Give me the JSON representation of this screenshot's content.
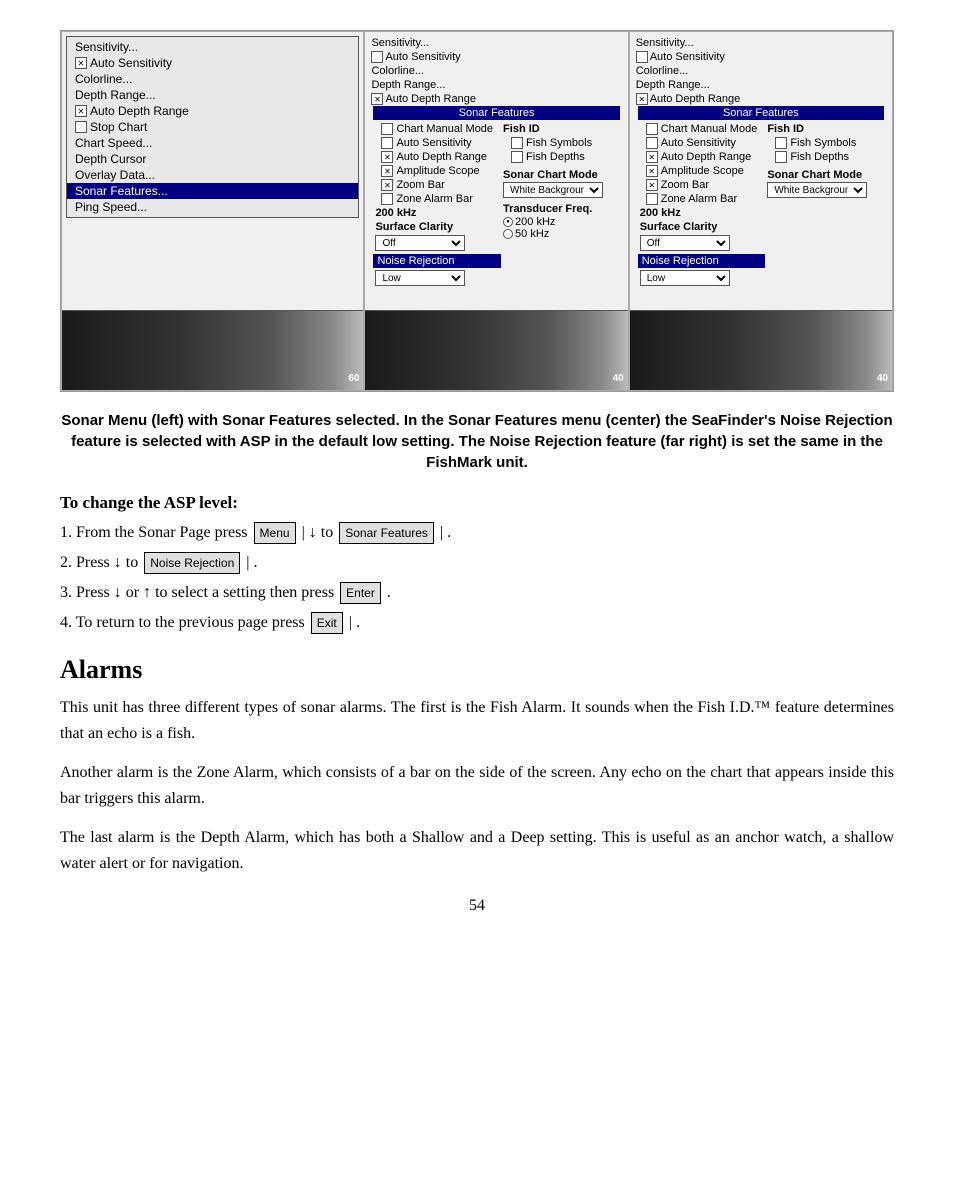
{
  "panels": {
    "left": {
      "menu_items": [
        {
          "label": "Sensitivity...",
          "selected": false,
          "checkbox": false
        },
        {
          "label": "Auto Sensitivity",
          "selected": false,
          "checkbox": true,
          "checked": true
        },
        {
          "label": "Colorline...",
          "selected": false,
          "checkbox": false
        },
        {
          "label": "Depth Range...",
          "selected": false,
          "checkbox": false
        },
        {
          "label": "Auto Depth Range",
          "selected": false,
          "checkbox": true,
          "checked": true
        },
        {
          "label": "Stop Chart",
          "selected": false,
          "checkbox": true,
          "checked": false
        },
        {
          "label": "Chart Speed...",
          "selected": false,
          "checkbox": false
        },
        {
          "label": "Depth Cursor",
          "selected": false,
          "checkbox": false
        },
        {
          "label": "Overlay Data...",
          "selected": false,
          "checkbox": false
        },
        {
          "label": "Sonar Features...",
          "selected": true,
          "checkbox": false
        },
        {
          "label": "Ping Speed...",
          "selected": false,
          "checkbox": false
        }
      ],
      "depth": "60"
    },
    "center": {
      "header": "Sonar Features",
      "col1_items": [
        {
          "label": "Chart Manual Mode",
          "checked": false
        },
        {
          "label": "Auto Sensitivity",
          "checked": false
        },
        {
          "label": "Auto Depth Range",
          "checked": true
        },
        {
          "label": "Amplitude Scope",
          "checked": true
        },
        {
          "label": "Zoom Bar",
          "checked": true
        },
        {
          "label": "Zone Alarm Bar",
          "checked": false
        }
      ],
      "freq_label": "200 kHz",
      "surface_label": "Surface Clarity",
      "surface_value": "Off",
      "noise_label": "Noise Rejection",
      "noise_value": "Low",
      "col2_title": "Fish ID",
      "fish_symbols": {
        "label": "Fish Symbols",
        "checked": false
      },
      "fish_depths": {
        "label": "Fish Depths",
        "checked": false
      },
      "chart_mode_label": "Sonar Chart Mode",
      "chart_mode_value": "White Background",
      "transducer_label": "Transducer Freq.",
      "transducer_200": "200 kHz",
      "transducer_50": "50 kHz",
      "transducer_200_selected": true,
      "depth": "40"
    },
    "right": {
      "header": "Sonar Features",
      "col1_items": [
        {
          "label": "Chart Manual Mode",
          "checked": false
        },
        {
          "label": "Auto Sensitivity",
          "checked": false
        },
        {
          "label": "Auto Depth Range",
          "checked": true
        },
        {
          "label": "Amplitude Scope",
          "checked": true
        },
        {
          "label": "Zoom Bar",
          "checked": true
        },
        {
          "label": "Zone Alarm Bar",
          "checked": false
        }
      ],
      "freq_label": "200 kHz",
      "surface_label": "Surface Clarity",
      "surface_value": "Off",
      "noise_label": "Noise Rejection",
      "noise_value": "Low",
      "col2_title": "Fish ID",
      "fish_symbols": {
        "label": "Fish Symbols",
        "checked": false
      },
      "fish_depths": {
        "label": "Fish Depths",
        "checked": false
      },
      "chart_mode_label": "Sonar Chart Mode",
      "chart_mode_value": "White Background",
      "depth": "40"
    }
  },
  "caption": "Sonar Menu (left) with Sonar Features selected. In the Sonar Features menu (center) the SeaFinder's Noise Rejection feature is selected with ASP in the default low  setting. The Noise Rejection feature (far right) is set the same in the FishMark unit.",
  "instructions": {
    "title": "To change the ASP level:",
    "steps": [
      "1. From the Sonar Page press",
      "2. Press ↓ to",
      "3. Press ↓ or ↑ to select a setting then press",
      "4. To return to the previous page press"
    ],
    "step1_suffix": "| ↓ to",
    "step1_end": "|     .",
    "step2_end": "|   .",
    "step3_end": ".",
    "step4_end": "|    ."
  },
  "alarms": {
    "title": "Alarms",
    "para1": "This unit has three different types of sonar alarms. The first is the Fish Alarm. It sounds when the Fish I.D.™ feature determines that an echo is a fish.",
    "para2": "Another alarm is the Zone Alarm, which consists of a bar on the side of the screen. Any echo on the chart that appears inside this bar triggers this alarm.",
    "para3": "The last alarm is the Depth Alarm, which has both a Shallow and a Deep setting. This is useful as an anchor watch, a shallow water alert or for navigation."
  },
  "page_number": "54"
}
